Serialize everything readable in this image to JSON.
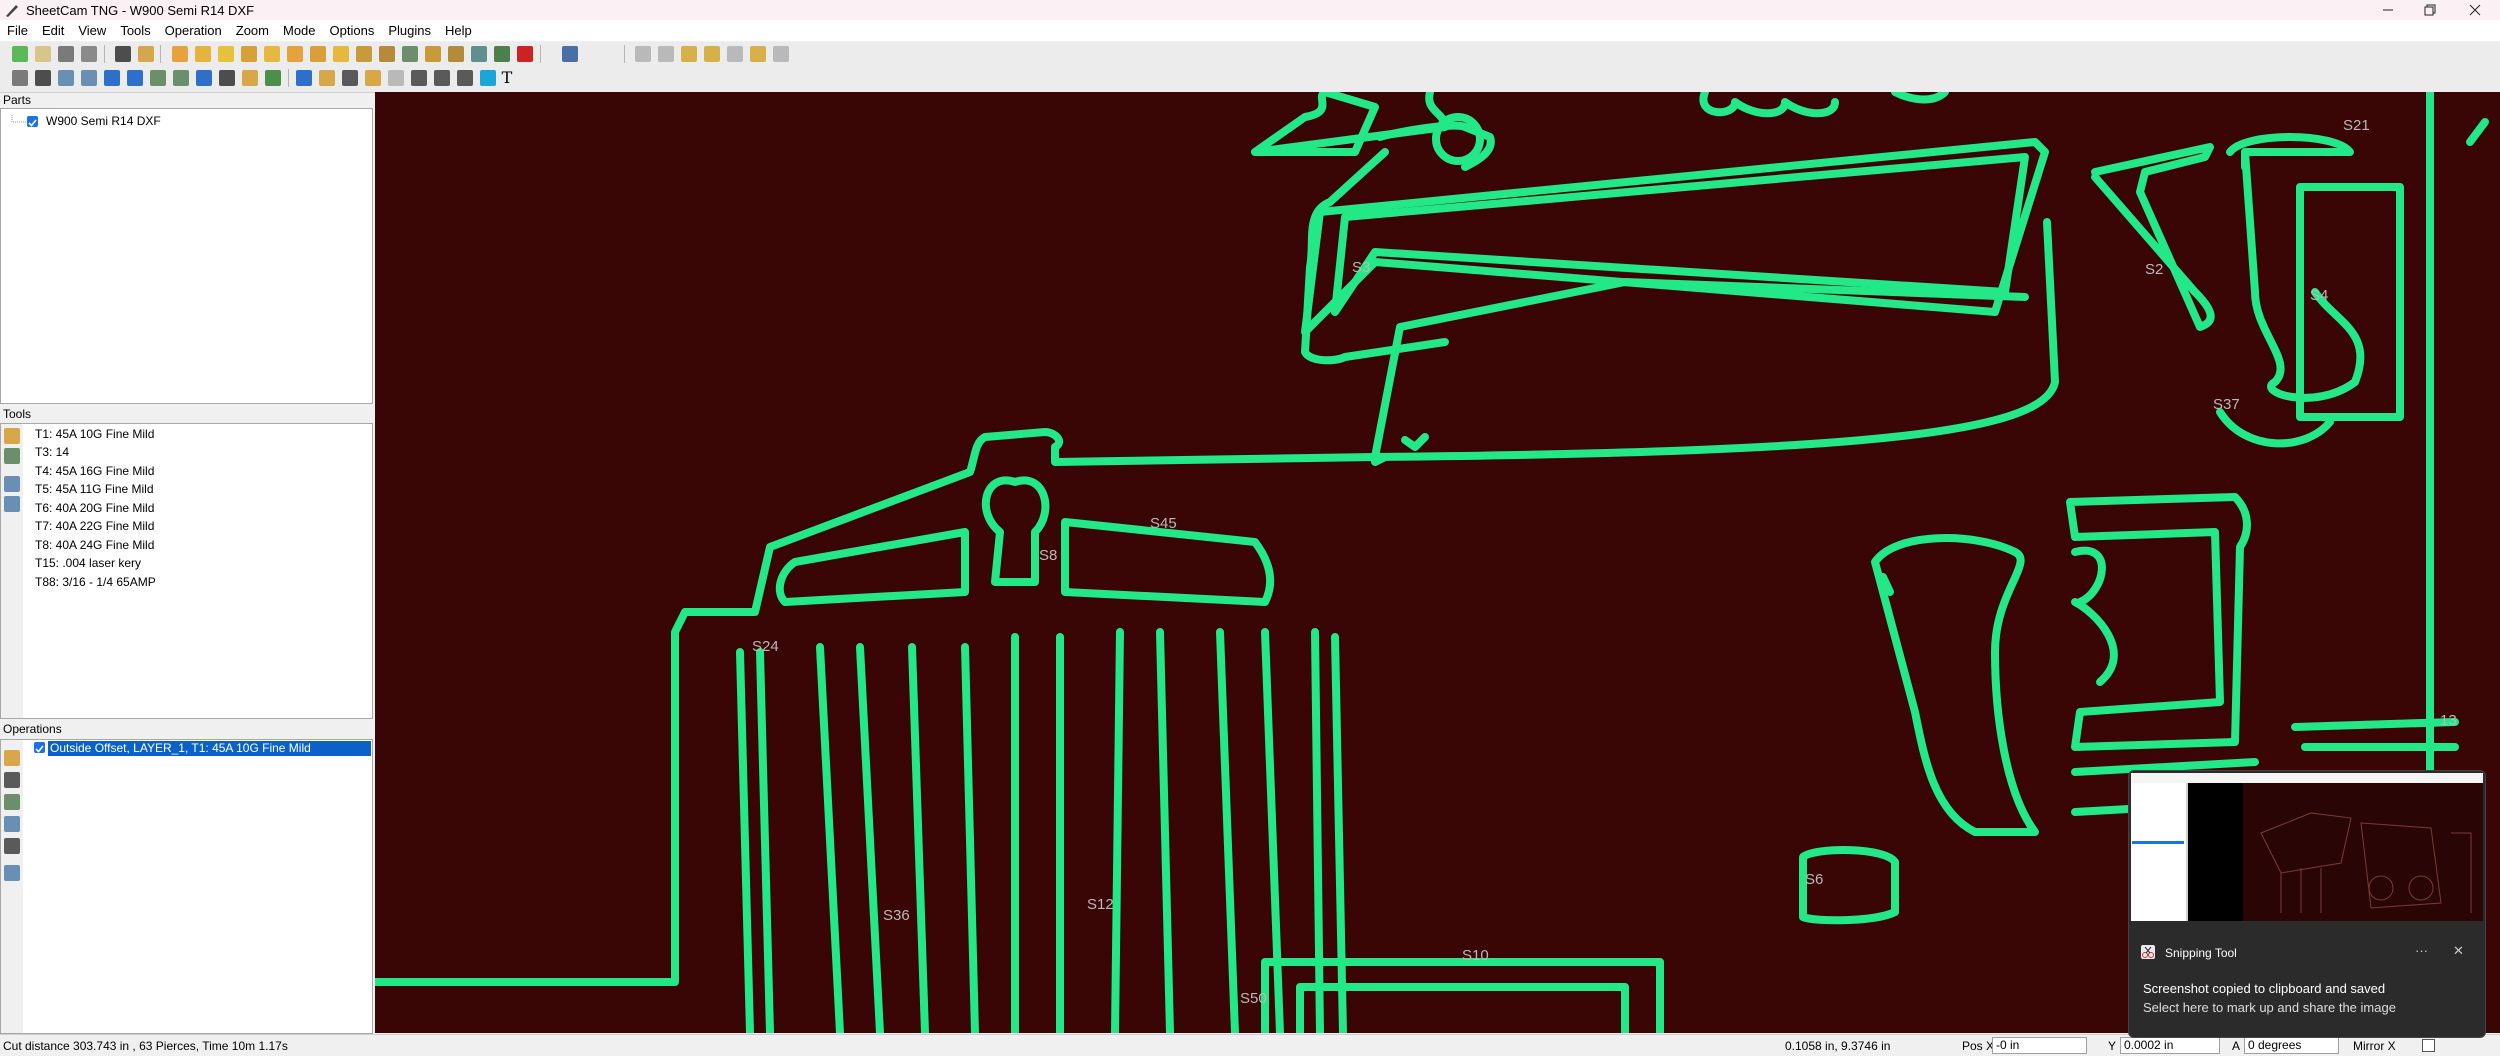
{
  "window": {
    "title": "SheetCam TNG - W900 Semi R14 DXF",
    "controls": [
      "minimize",
      "restore",
      "close"
    ]
  },
  "menu": [
    "File",
    "Edit",
    "View",
    "Tools",
    "Operation",
    "Zoom",
    "Mode",
    "Options",
    "Plugins",
    "Help"
  ],
  "parts": {
    "header": "Parts",
    "items": [
      {
        "label": "W900 Semi R14 DXF",
        "checked": true
      }
    ]
  },
  "tools": {
    "header": "Tools",
    "items": [
      "T1: 45A 10G Fine Mild",
      "T3: 14",
      "T4: 45A 16G Fine Mild",
      "T5: 45A 11G Fine Mild",
      "T6: 40A 20G Fine Mild",
      "T7: 40A 22G Fine Mild",
      "T8: 40A 24G Fine Mild",
      "T15: .004 laser kery",
      "T88: 3/16 - 1/4 65AMP"
    ]
  },
  "operations": {
    "header": "Operations",
    "items": [
      {
        "label": "Outside Offset, LAYER_1, T1: 45A 10G Fine Mild",
        "checked": true,
        "selected": true
      }
    ]
  },
  "canvas": {
    "background": "#3a0505",
    "path_color": "#22e888",
    "label_color": "#b9b9b9",
    "labels": [
      "S21",
      "S37",
      "S45",
      "S8",
      "S24",
      "S36",
      "S12",
      "S10",
      "S50",
      "S6",
      "13",
      "S3",
      "S2",
      "S4"
    ]
  },
  "status": {
    "cut_info": "Cut distance 303.743 in , 63 Pierces, Time 10m 1.17s",
    "cursor": "0.1058 in, 9.3746 in",
    "pos_x_label": "Pos X",
    "pos_x_value": "-0 in",
    "y_label": "Y",
    "y_value": "0.0002 in",
    "a_label": "A",
    "a_value": "0 degrees",
    "mirror_label": "Mirror X"
  },
  "toast": {
    "app_name": "Snipping Tool",
    "more": "···",
    "close": "✕",
    "message": "Screenshot copied to clipboard and saved",
    "sub": "Select here to mark up and share the image"
  }
}
